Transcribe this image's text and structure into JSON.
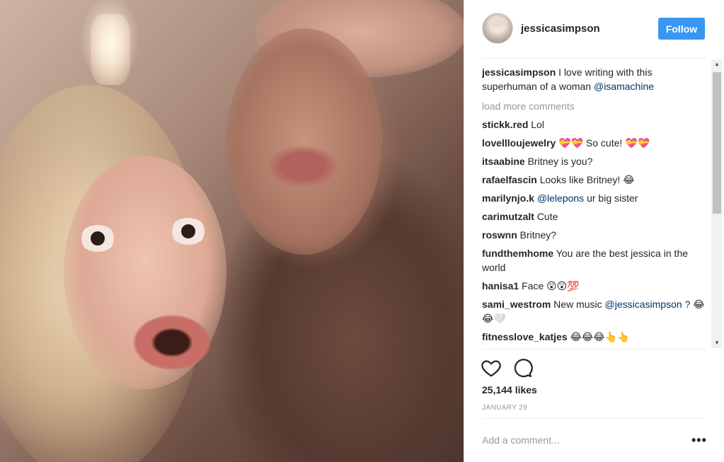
{
  "header": {
    "username": "jessicasimpson",
    "follow_label": "Follow"
  },
  "caption": {
    "user": "jessicasimpson",
    "text": "I love writing with this superhuman of a woman",
    "mention": "@isamachine"
  },
  "load_more_label": "load more comments",
  "comments": [
    {
      "user": "stickk.red",
      "text": "Lol"
    },
    {
      "user": "lovellloujewelry",
      "text": "💝💝 So cute! 💝💝"
    },
    {
      "user": "itsaabine",
      "text": "Britney is you?"
    },
    {
      "user": "rafaelfascin",
      "text": "Looks like Britney! 😂"
    },
    {
      "user": "marilynjo.k",
      "mention": "@lelepons",
      "text": "ur big sister"
    },
    {
      "user": "carimutzalt",
      "text": "Cute"
    },
    {
      "user": "roswnn",
      "text": "Britney?"
    },
    {
      "user": "fundthemhome",
      "text": "You are the best jessica in the world"
    },
    {
      "user": "hanisa1",
      "text": "Face 😲😲💯"
    },
    {
      "user": "sami_westrom",
      "text": "New music",
      "mention": "@jessicasimpson",
      "text_after": "? 😂😂🤍"
    },
    {
      "user": "fitnesslove_katjes",
      "text": "😂😂😂👆👆"
    }
  ],
  "likes": "25,144 likes",
  "date": "JANUARY 29",
  "add_comment_placeholder": "Add a comment...",
  "more_label": "•••",
  "icons": {
    "like": "heart-icon",
    "comment": "comment-bubble-icon",
    "more": "more-options-icon"
  },
  "colors": {
    "accent": "#3897f0",
    "mention": "#003569",
    "muted": "#999999"
  }
}
